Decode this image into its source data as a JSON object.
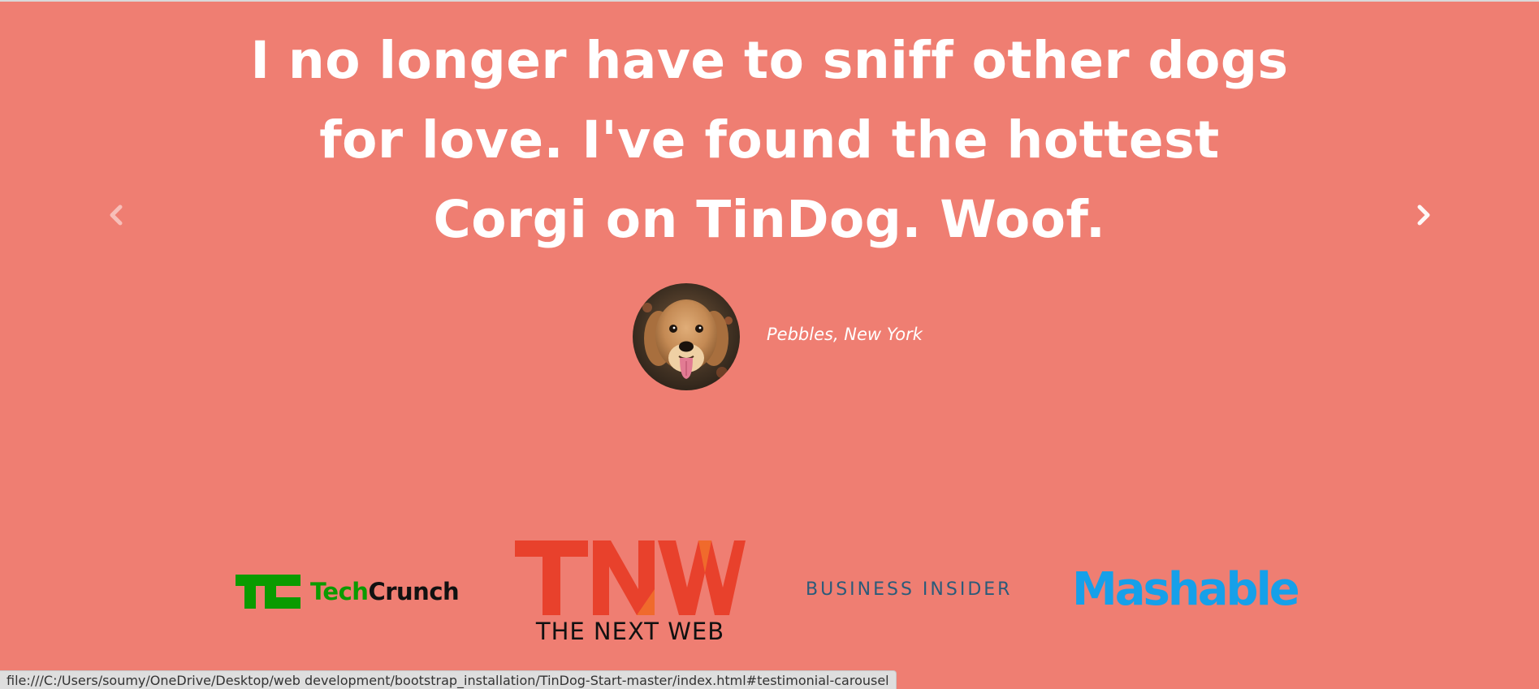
{
  "testimonial": {
    "quote": "I no longer have to sniff other dogs for love. I've found the hottest Corgi on TinDog. Woof.",
    "author": "Pebbles, New York",
    "avatar_icon": "golden-retriever-photo"
  },
  "carousel": {
    "prev_icon": "chevron-left-icon",
    "next_icon": "chevron-right-icon"
  },
  "press": {
    "logos": [
      {
        "name": "TechCrunch",
        "mark": "TC",
        "text_green": "Tech",
        "text_dark": "Crunch",
        "color": "#0a9b00"
      },
      {
        "name": "The Next Web",
        "mark": "TNW",
        "sub": "THE NEXT WEB",
        "color": "#e8412c"
      },
      {
        "name": "Business Insider",
        "text": "BUSINESS INSIDER",
        "color": "#2a5b7a"
      },
      {
        "name": "Mashable",
        "text": "Mashable",
        "color": "#16a0e9"
      }
    ]
  },
  "status_bar": {
    "url": "file:///C:/Users/soumy/OneDrive/Desktop/web development/bootstrap_installation/TinDog-Start-master/index.html#testimonial-carousel"
  },
  "colors": {
    "background": "#ef7e72",
    "text": "#ffffff"
  }
}
